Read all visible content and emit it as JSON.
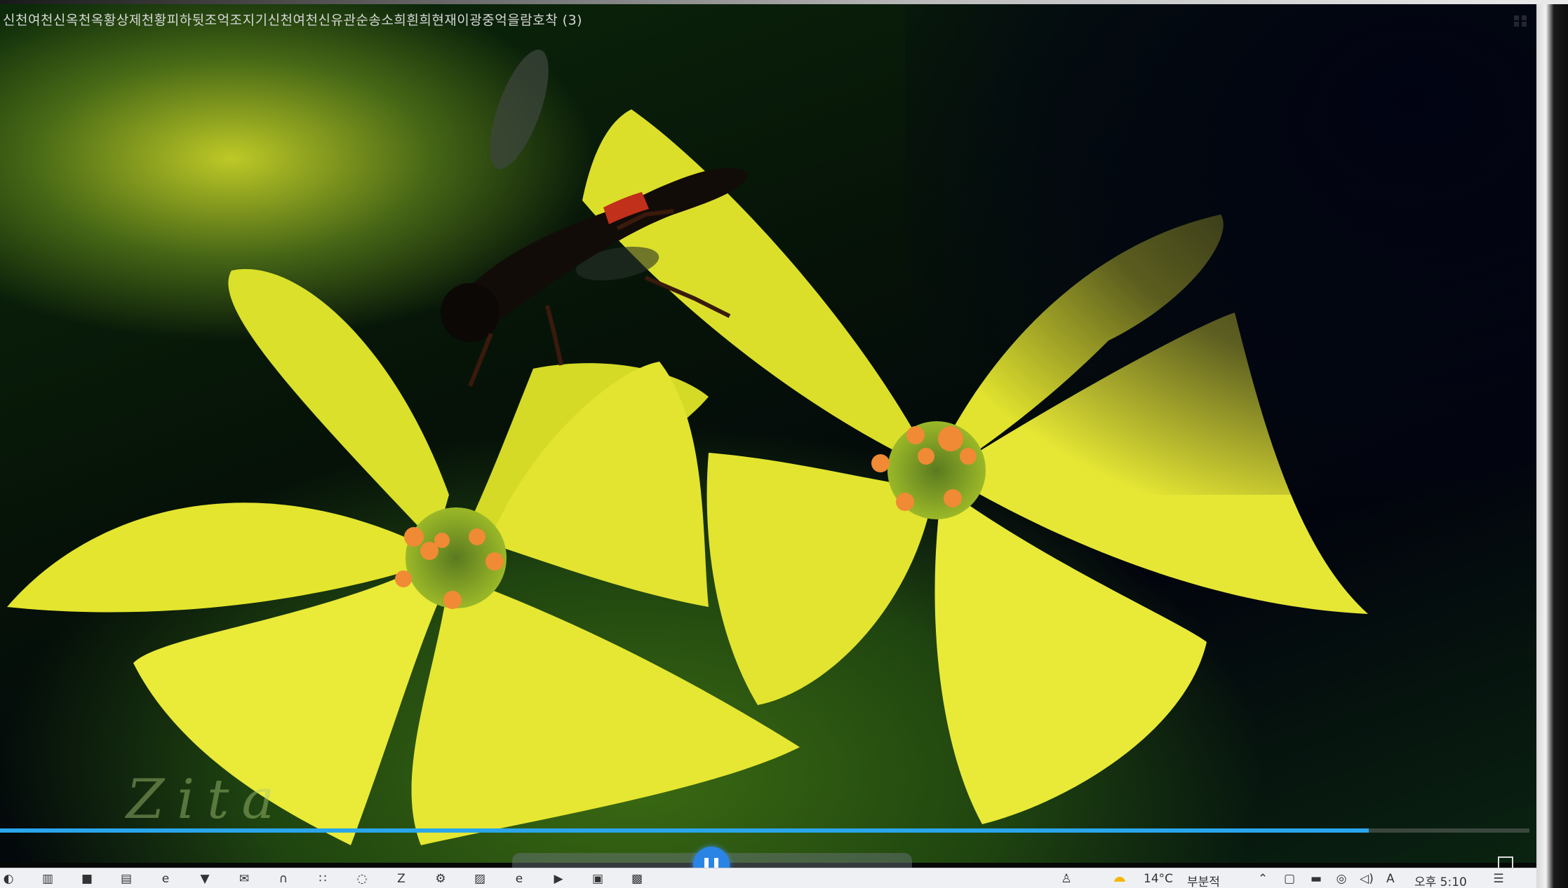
{
  "window": {
    "title": "신천여천신옥천옥황상제천황피하뒷조억조지기신천여천신유관순송소희흰희현재이광중억을람호착 (3)"
  },
  "video": {
    "watermark": "Zita",
    "progress_percent": 89.5
  },
  "taskbar": {
    "apps": [
      {
        "icon": "windows-start-icon",
        "glyph": "◐"
      },
      {
        "icon": "task-view-icon",
        "glyph": "▥"
      },
      {
        "icon": "office-icon",
        "glyph": "■"
      },
      {
        "icon": "file-explorer-icon",
        "glyph": "▤"
      },
      {
        "icon": "edge-browser-icon",
        "glyph": "e"
      },
      {
        "icon": "mcafee-icon",
        "glyph": "▼"
      },
      {
        "icon": "mail-icon",
        "glyph": "✉"
      },
      {
        "icon": "headset-icon",
        "glyph": "∩"
      },
      {
        "icon": "apps-grid-icon",
        "glyph": "∷"
      },
      {
        "icon": "messenger-icon",
        "glyph": "◌"
      },
      {
        "icon": "filezilla-icon",
        "glyph": "Z"
      },
      {
        "icon": "settings-gear-icon",
        "glyph": "⚙"
      },
      {
        "icon": "image-viewer-icon",
        "glyph": "▨"
      },
      {
        "icon": "internet-explorer-icon",
        "glyph": "e"
      },
      {
        "icon": "media-player-icon",
        "glyph": "▶"
      },
      {
        "icon": "adobe-reader-icon",
        "glyph": "▣"
      },
      {
        "icon": "pdf-tool-icon",
        "glyph": "▩"
      }
    ],
    "tray": {
      "people_glyph": "♙",
      "temperature": "14°C",
      "weather": "부분적",
      "chevron_glyph": "⌃",
      "meet_glyph": "▢",
      "battery_glyph": "▬",
      "network_glyph": "◎",
      "volume_glyph": "◁)",
      "ime": "A",
      "time": "오후 5:10",
      "notifications_glyph": "☰"
    },
    "colors": {
      "accent": "#2a84e6",
      "progress": "#2aa6ec"
    }
  }
}
